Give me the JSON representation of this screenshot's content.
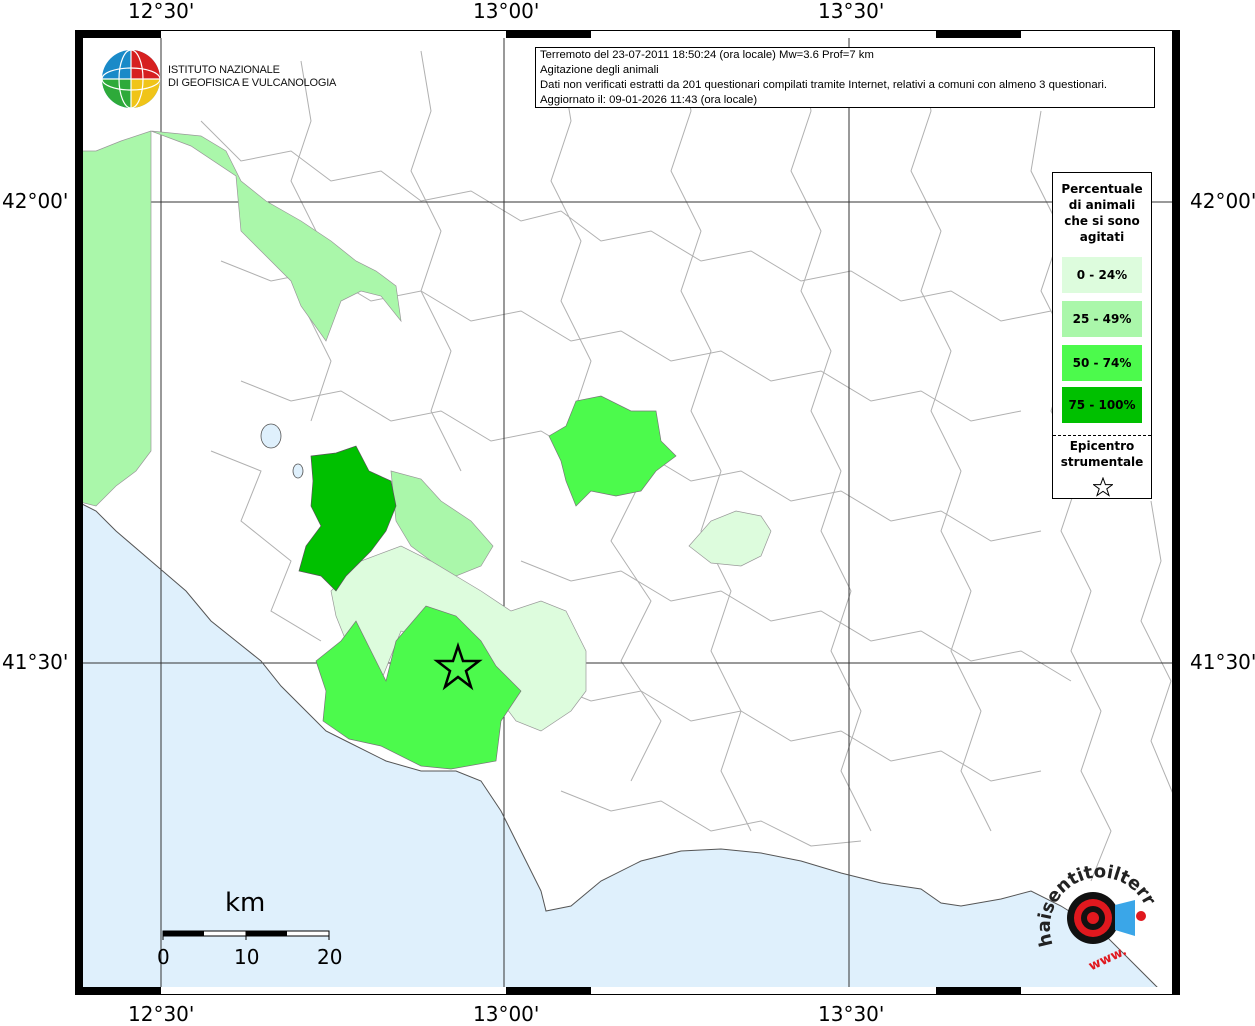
{
  "ticks": {
    "lon_top": [
      "12°30'",
      "13°00'",
      "13°30'"
    ],
    "lon_bottom": [
      "12°30'",
      "13°00'",
      "13°30'"
    ],
    "lat_left": [
      "42°00'",
      "41°30'"
    ],
    "lat_right": [
      "42°00'",
      "41°30'"
    ]
  },
  "info": {
    "line1": "Terremoto del 23-07-2011 18:50:24 (ora locale) Mw=3.6 Prof=7 km",
    "line2": "Agitazione degli animali",
    "line3": "Dati non verificati estratti da 201 questionari compilati tramite Internet, relativi a comuni con almeno 3 questionari.",
    "line4": "Aggiornato il: 09-01-2026 11:43 (ora locale)"
  },
  "logo": {
    "line1": "ISTITUTO NAZIONALE",
    "line2": "DI GEOFISICA E VULCANOLOGIA"
  },
  "legend": {
    "title_lines": [
      "Percentuale",
      "di animali",
      "che si sono",
      "agitati"
    ],
    "classes": [
      {
        "label": "0 - 24%",
        "color": "#ddfcdd"
      },
      {
        "label": "25 - 49%",
        "color": "#aaf7aa"
      },
      {
        "label": "50 - 74%",
        "color": "#4cfa4c"
      },
      {
        "label": "75 - 100%",
        "color": "#00c000"
      }
    ],
    "epicenter_lines": [
      "Epicentro",
      "strumentale"
    ]
  },
  "scale": {
    "unit": "km",
    "labels": [
      "0",
      "10",
      "20"
    ]
  },
  "colors": {
    "sea": "#dff0fc",
    "land": "#ffffff",
    "border": "#aaaaaa"
  },
  "sentito_logo": {
    "text": "haisentitoilterremoto.it",
    "url_text": "www."
  }
}
